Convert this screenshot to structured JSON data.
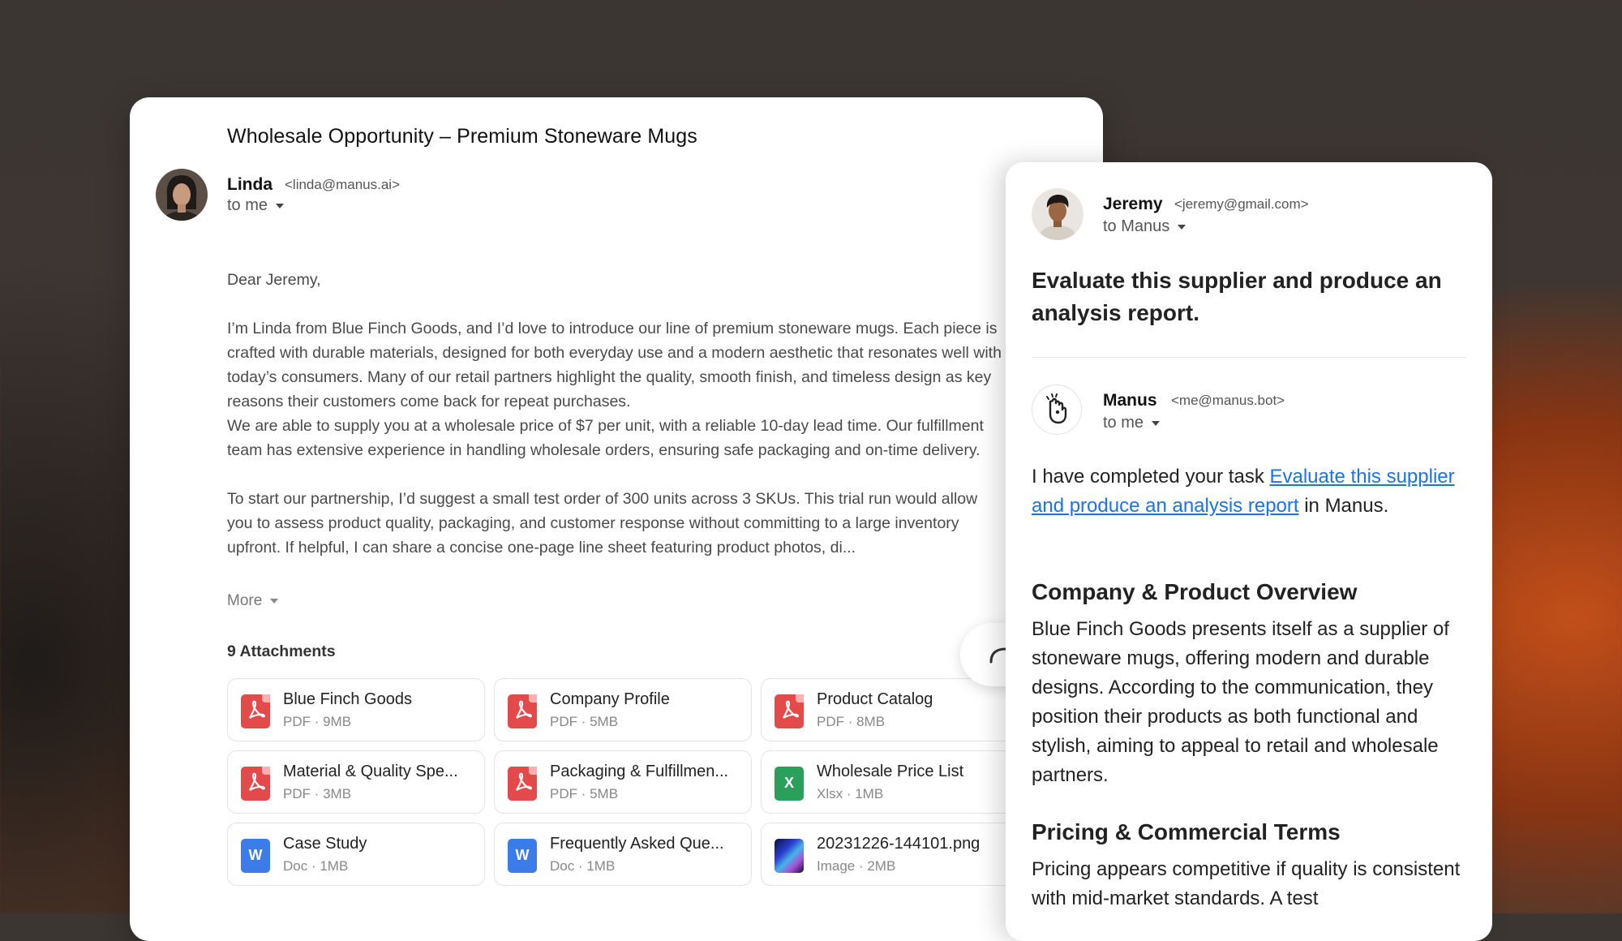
{
  "left_email": {
    "subject": "Wholesale Opportunity – Premium Stoneware Mugs",
    "sender_name": "Linda",
    "sender_email": "<linda@manus.ai>",
    "recipient": "to me",
    "greeting": "Dear Jeremy,",
    "paragraph1": "I’m Linda from Blue Finch Goods, and I’d love to introduce our line of premium stoneware mugs. Each piece is crafted with durable materials, designed for both everyday use and a modern aesthetic that resonates well with today’s consumers. Many of our retail partners highlight the quality, smooth finish, and timeless design as key reasons their customers come back for repeat purchases.",
    "paragraph2": "We are able to supply you at a wholesale price of $7 per unit, with a reliable 10-day lead time. Our fulfillment team has extensive experience in handling wholesale orders, ensuring safe packaging and on-time delivery.",
    "paragraph3": "To start our partnership, I’d suggest a small test order of 300 units across 3 SKUs. This trial run would allow you to assess product quality, packaging, and customer response without committing to a large inventory upfront. If helpful, I can share a concise one-page line sheet featuring product photos, di...",
    "more_label": "More",
    "attachments_title": "9 Attachments",
    "attachments": [
      {
        "name": "Blue Finch Goods",
        "meta": "PDF · 9MB",
        "type": "pdf"
      },
      {
        "name": "Company Profile",
        "meta": "PDF · 5MB",
        "type": "pdf"
      },
      {
        "name": "Product Catalog",
        "meta": "PDF · 8MB",
        "type": "pdf"
      },
      {
        "name": "Material & Quality Spe...",
        "meta": "PDF · 3MB",
        "type": "pdf"
      },
      {
        "name": "Packaging & Fulfillmen...",
        "meta": "PDF · 5MB",
        "type": "pdf"
      },
      {
        "name": "Wholesale Price List",
        "meta": "Xlsx · 1MB",
        "type": "xlsx",
        "glyph": "X"
      },
      {
        "name": "Case Study",
        "meta": "Doc · 1MB",
        "type": "doc",
        "glyph": "W"
      },
      {
        "name": "Frequently Asked Que...",
        "meta": "Doc · 1MB",
        "type": "doc",
        "glyph": "W"
      },
      {
        "name": "20231226-144101.png",
        "meta": "Image · 2MB",
        "type": "image"
      }
    ]
  },
  "right_email": {
    "forwarder_name": "Jeremy",
    "forwarder_email": "<jeremy@gmail.com>",
    "forwarder_recipient": "to Manus",
    "request": "Evaluate this supplier and produce an analysis report.",
    "reply_name": "Manus",
    "reply_email": "<me@manus.bot>",
    "reply_recipient": "to me",
    "intro_before": "I have completed your task ",
    "intro_link": "Evaluate this supplier and produce an analysis report",
    "intro_after": " in Manus.",
    "section1_heading": "Company & Product Overview",
    "section1_text": "Blue Finch Goods presents itself as a supplier of stoneware mugs, offering modern and durable designs. According to the communication, they position their products as both functional and stylish, aiming to appeal to retail and wholesale partners.",
    "section2_heading": "Pricing & Commercial Terms",
    "section2_text": "Pricing appears competitive if quality is consistent with mid-market standards. A test"
  },
  "icons": {
    "share": "forward-arrow-icon",
    "manus_logo": "manus-hand-icon"
  },
  "colors": {
    "link": "#1a73e8",
    "pdf": "#e54a4a",
    "xlsx": "#2aa05a",
    "doc": "#3b7ce9"
  }
}
